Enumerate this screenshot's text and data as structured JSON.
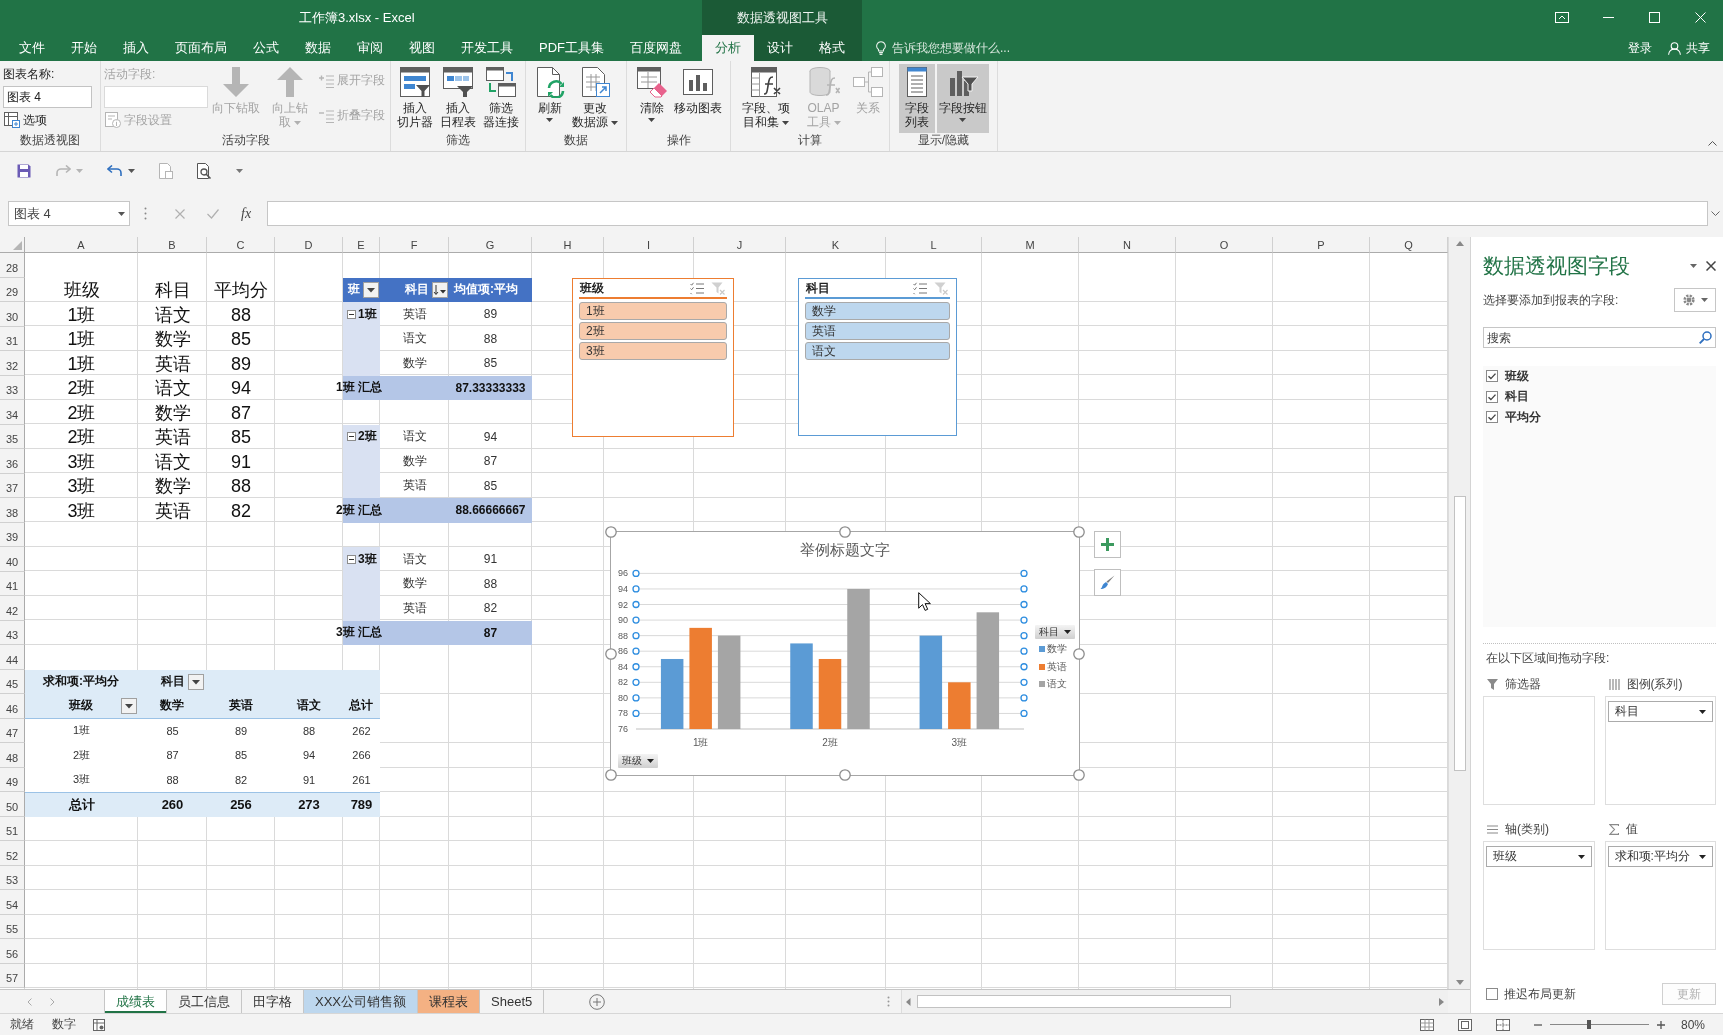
{
  "window": {
    "title": "工作簿3.xlsx - Excel",
    "context_title": "数据透视图工具",
    "sign_in": "登录",
    "share": "共享"
  },
  "ribbon_tabs": [
    {
      "label": "文件",
      "selected": false,
      "contextual": false
    },
    {
      "label": "开始",
      "selected": false,
      "contextual": false
    },
    {
      "label": "插入",
      "selected": false,
      "contextual": false
    },
    {
      "label": "页面布局",
      "selected": false,
      "contextual": false
    },
    {
      "label": "公式",
      "selected": false,
      "contextual": false
    },
    {
      "label": "数据",
      "selected": false,
      "contextual": false
    },
    {
      "label": "审阅",
      "selected": false,
      "contextual": false
    },
    {
      "label": "视图",
      "selected": false,
      "contextual": false
    },
    {
      "label": "开发工具",
      "selected": false,
      "contextual": false
    },
    {
      "label": "PDF工具集",
      "selected": false,
      "contextual": false
    },
    {
      "label": "百度网盘",
      "selected": false,
      "contextual": false
    },
    {
      "label": "分析",
      "selected": true,
      "contextual": true
    },
    {
      "label": "设计",
      "selected": false,
      "contextual": true
    },
    {
      "label": "格式",
      "selected": false,
      "contextual": true
    }
  ],
  "tell_me": {
    "placeholder": "告诉我您想要做什么..."
  },
  "ribbon": {
    "groups": [
      {
        "label": "数据透视图",
        "columns": [
          [
            {
              "kind": "caption",
              "text": "图表名称:",
              "disabled": false
            },
            {
              "kind": "field",
              "value": "图表 4",
              "disabled": false
            },
            {
              "kind": "small",
              "label": "选项",
              "disabled": false
            }
          ]
        ]
      },
      {
        "label": "活动字段",
        "columns": [
          [
            {
              "kind": "caption",
              "text": "活动字段:",
              "disabled": true
            },
            {
              "kind": "field",
              "disabled": true
            },
            {
              "kind": "small",
              "label": "字段设置",
              "disabled": true
            }
          ],
          [
            {
              "kind": "large",
              "label": "向下钻取",
              "disabled": true,
              "dropdown": false,
              "pressed": false
            }
          ],
          [
            {
              "kind": "large",
              "label": "向上钻取",
              "disabled": true,
              "dropdown": true,
              "pressed": false
            }
          ],
          [
            {
              "kind": "small",
              "label": "展开字段",
              "disabled": true
            },
            {
              "kind": "small",
              "label": "折叠字段",
              "disabled": true
            }
          ]
        ]
      },
      {
        "label": "筛选",
        "columns": [
          [
            {
              "kind": "large",
              "label": "插入切片器",
              "disabled": false,
              "dropdown": false,
              "pressed": false
            }
          ],
          [
            {
              "kind": "large",
              "label": "插入日程表",
              "disabled": false,
              "dropdown": false,
              "pressed": false
            }
          ],
          [
            {
              "kind": "large",
              "label": "筛选器连接",
              "disabled": false,
              "dropdown": false,
              "pressed": false
            }
          ]
        ]
      },
      {
        "label": "数据",
        "columns": [
          [
            {
              "kind": "large",
              "label": "刷新",
              "disabled": false,
              "dropdown": true,
              "pressed": false
            }
          ],
          [
            {
              "kind": "large",
              "label": "更改数据源",
              "disabled": false,
              "dropdown": true,
              "pressed": false
            }
          ]
        ]
      },
      {
        "label": "操作",
        "columns": [
          [
            {
              "kind": "large",
              "label": "清除",
              "disabled": false,
              "dropdown": true,
              "pressed": false
            }
          ],
          [
            {
              "kind": "large",
              "label": "移动图表",
              "disabled": false,
              "dropdown": false,
              "pressed": false
            }
          ]
        ]
      },
      {
        "label": "计算",
        "columns": [
          [
            {
              "kind": "large",
              "label": "字段、项目和集",
              "disabled": false,
              "dropdown": true,
              "pressed": false
            }
          ],
          [
            {
              "kind": "large",
              "label": "OLAP工具",
              "disabled": true,
              "dropdown": true,
              "pressed": false
            }
          ],
          [
            {
              "kind": "large",
              "label": "关系",
              "disabled": true,
              "dropdown": false,
              "pressed": false
            }
          ]
        ]
      },
      {
        "label": "显示/隐藏",
        "columns": [
          [
            {
              "kind": "large",
              "label": "字段列表",
              "disabled": false,
              "dropdown": false,
              "pressed": true
            }
          ],
          [
            {
              "kind": "large",
              "label": "字段按钮",
              "disabled": false,
              "dropdown": true,
              "pressed": true
            }
          ]
        ]
      }
    ]
  },
  "quick_access": [
    {
      "disabled": false,
      "dropdown": false
    },
    {
      "disabled": true,
      "dropdown": true
    },
    {
      "disabled": false,
      "dropdown": true
    },
    {
      "disabled": true,
      "dropdown": false
    },
    {
      "disabled": false,
      "dropdown": false
    }
  ],
  "formula_bar": {
    "name_box": "图表 4",
    "function_button": "fx"
  },
  "sheet": {
    "columns": [
      "A",
      "B",
      "C",
      "D",
      "E",
      "F",
      "G",
      "H",
      "I",
      "J",
      "K",
      "L",
      "M",
      "N",
      "O",
      "P",
      "Q"
    ],
    "rows": [
      "28",
      "29",
      "30",
      "31",
      "32",
      "33",
      "34",
      "35",
      "36",
      "37",
      "38",
      "39",
      "40",
      "41",
      "42",
      "43",
      "44",
      "45",
      "46",
      "47",
      "48",
      "49",
      "50",
      "51",
      "52",
      "53",
      "54",
      "55",
      "56",
      "57"
    ]
  },
  "source_table": {
    "header": [
      "班级",
      "科目",
      "平均分"
    ],
    "rows": [
      [
        "1班",
        "语文",
        "88"
      ],
      [
        "1班",
        "数学",
        "85"
      ],
      [
        "1班",
        "英语",
        "89"
      ],
      [
        "2班",
        "语文",
        "94"
      ],
      [
        "2班",
        "数学",
        "87"
      ],
      [
        "2班",
        "英语",
        "85"
      ],
      [
        "3班",
        "语文",
        "91"
      ],
      [
        "3班",
        "数学",
        "88"
      ],
      [
        "3班",
        "英语",
        "82"
      ]
    ]
  },
  "pivot_table": {
    "headers": [
      "班",
      "科目",
      "均值项:平均"
    ],
    "groups": [
      {
        "label": "1班",
        "expanded": true,
        "items": [
          [
            "英语",
            "89"
          ],
          [
            "语文",
            "88"
          ],
          [
            "数学",
            "85"
          ]
        ],
        "total_label": "1班 汇总",
        "total": "87.33333333"
      },
      {
        "label": "2班",
        "expanded": true,
        "items": [
          [
            "语文",
            "94"
          ],
          [
            "数学",
            "87"
          ],
          [
            "英语",
            "85"
          ]
        ],
        "total_label": "2班 汇总",
        "total": "88.66666667"
      },
      {
        "label": "3班",
        "expanded": true,
        "items": [
          [
            "语文",
            "91"
          ],
          [
            "数学",
            "88"
          ],
          [
            "英语",
            "82"
          ]
        ],
        "total_label": "3班 汇总",
        "total": "87"
      }
    ]
  },
  "crosstab": {
    "value_field": "求和项:平均分",
    "column_field": "科目",
    "row_field": "班级",
    "columns": [
      "数学",
      "英语",
      "语文",
      "总计"
    ],
    "rows": [
      {
        "label": "1班",
        "values": [
          "85",
          "89",
          "88",
          "262"
        ]
      },
      {
        "label": "2班",
        "values": [
          "87",
          "85",
          "94",
          "266"
        ]
      },
      {
        "label": "3班",
        "values": [
          "88",
          "82",
          "91",
          "261"
        ]
      }
    ],
    "total": {
      "label": "总计",
      "values": [
        "260",
        "256",
        "273",
        "789"
      ]
    }
  },
  "slicers": [
    {
      "title": "班级",
      "color": "#ed7d31",
      "items": [
        {
          "label": "1班",
          "selected": true
        },
        {
          "label": "2班",
          "selected": true
        },
        {
          "label": "3班",
          "selected": true
        }
      ]
    },
    {
      "title": "科目",
      "color": "#5b9bd5",
      "items": [
        {
          "label": "数学",
          "selected": true
        },
        {
          "label": "英语",
          "selected": true
        },
        {
          "label": "语文",
          "selected": true
        }
      ]
    }
  ],
  "chart": {
    "legend_field": "科目",
    "axis_field": "班级",
    "chart_data": {
      "type": "bar",
      "title": "举例标题文字",
      "categories": [
        "1班",
        "2班",
        "3班"
      ],
      "series": [
        {
          "name": "数学",
          "color": "#5b9bd5",
          "values": [
            85,
            87,
            88
          ]
        },
        {
          "name": "英语",
          "color": "#ed7d31",
          "values": [
            89,
            85,
            82
          ]
        },
        {
          "name": "语文",
          "color": "#a5a5a5",
          "values": [
            88,
            94,
            91
          ]
        }
      ],
      "ylim": [
        76,
        96
      ],
      "yticks": [
        76,
        78,
        80,
        82,
        84,
        86,
        88,
        90,
        92,
        94,
        96
      ],
      "grid": true,
      "legend": "right"
    }
  },
  "field_panel": {
    "title": "数据透视图字段",
    "subtitle": "选择要添加到报表的字段:",
    "search": {
      "placeholder": "搜索"
    },
    "fields": [
      {
        "label": "班级",
        "checked": true
      },
      {
        "label": "科目",
        "checked": true
      },
      {
        "label": "平均分",
        "checked": true
      }
    ],
    "areas_caption": "在以下区域间拖动字段:",
    "areas": [
      {
        "kind": "filters",
        "title": "筛选器"
      },
      {
        "kind": "legend",
        "title": "图例(系列)",
        "items": [
          "科目"
        ]
      },
      {
        "kind": "axis",
        "title": "轴(类别)",
        "items": [
          "班级"
        ]
      },
      {
        "kind": "values",
        "title": "值",
        "items": [
          "求和项:平均分"
        ]
      }
    ],
    "defer_update": {
      "label": "推迟布局更新",
      "checked": false
    },
    "update_button": {
      "label": "更新",
      "disabled": true
    }
  },
  "sheet_tabs": [
    {
      "label": "成绩表",
      "selected": true
    },
    {
      "label": "员工信息",
      "selected": false
    },
    {
      "label": "田字格",
      "selected": false
    },
    {
      "label": "XXX公司销售额",
      "selected": false,
      "color": "#bdd7ee"
    },
    {
      "label": "课程表",
      "selected": false,
      "color": "#f4b183"
    },
    {
      "label": "Sheet5",
      "selected": false
    }
  ],
  "status_bar": {
    "mode": "就绪",
    "num_lock": "数字",
    "zoom": "80%",
    "zoom_slider": {
      "level": 0.39
    }
  }
}
